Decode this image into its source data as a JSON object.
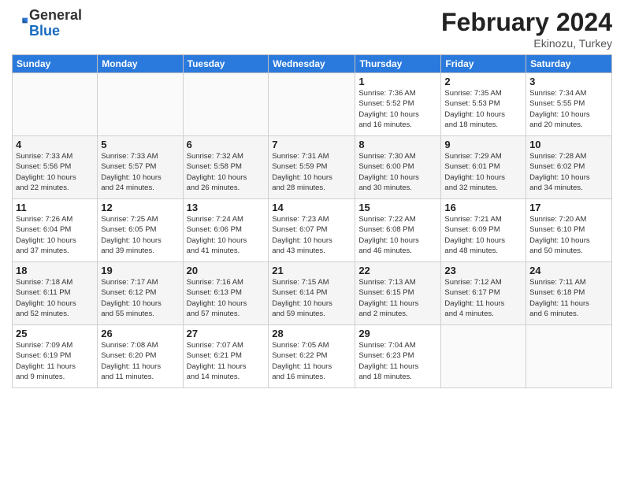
{
  "header": {
    "logo": {
      "general": "General",
      "blue": "Blue"
    },
    "title": "February 2024",
    "subtitle": "Ekinozu, Turkey"
  },
  "weekdays": [
    "Sunday",
    "Monday",
    "Tuesday",
    "Wednesday",
    "Thursday",
    "Friday",
    "Saturday"
  ],
  "weeks": [
    [
      {
        "day": "",
        "info": ""
      },
      {
        "day": "",
        "info": ""
      },
      {
        "day": "",
        "info": ""
      },
      {
        "day": "",
        "info": ""
      },
      {
        "day": "1",
        "info": "Sunrise: 7:36 AM\nSunset: 5:52 PM\nDaylight: 10 hours\nand 16 minutes."
      },
      {
        "day": "2",
        "info": "Sunrise: 7:35 AM\nSunset: 5:53 PM\nDaylight: 10 hours\nand 18 minutes."
      },
      {
        "day": "3",
        "info": "Sunrise: 7:34 AM\nSunset: 5:55 PM\nDaylight: 10 hours\nand 20 minutes."
      }
    ],
    [
      {
        "day": "4",
        "info": "Sunrise: 7:33 AM\nSunset: 5:56 PM\nDaylight: 10 hours\nand 22 minutes."
      },
      {
        "day": "5",
        "info": "Sunrise: 7:33 AM\nSunset: 5:57 PM\nDaylight: 10 hours\nand 24 minutes."
      },
      {
        "day": "6",
        "info": "Sunrise: 7:32 AM\nSunset: 5:58 PM\nDaylight: 10 hours\nand 26 minutes."
      },
      {
        "day": "7",
        "info": "Sunrise: 7:31 AM\nSunset: 5:59 PM\nDaylight: 10 hours\nand 28 minutes."
      },
      {
        "day": "8",
        "info": "Sunrise: 7:30 AM\nSunset: 6:00 PM\nDaylight: 10 hours\nand 30 minutes."
      },
      {
        "day": "9",
        "info": "Sunrise: 7:29 AM\nSunset: 6:01 PM\nDaylight: 10 hours\nand 32 minutes."
      },
      {
        "day": "10",
        "info": "Sunrise: 7:28 AM\nSunset: 6:02 PM\nDaylight: 10 hours\nand 34 minutes."
      }
    ],
    [
      {
        "day": "11",
        "info": "Sunrise: 7:26 AM\nSunset: 6:04 PM\nDaylight: 10 hours\nand 37 minutes."
      },
      {
        "day": "12",
        "info": "Sunrise: 7:25 AM\nSunset: 6:05 PM\nDaylight: 10 hours\nand 39 minutes."
      },
      {
        "day": "13",
        "info": "Sunrise: 7:24 AM\nSunset: 6:06 PM\nDaylight: 10 hours\nand 41 minutes."
      },
      {
        "day": "14",
        "info": "Sunrise: 7:23 AM\nSunset: 6:07 PM\nDaylight: 10 hours\nand 43 minutes."
      },
      {
        "day": "15",
        "info": "Sunrise: 7:22 AM\nSunset: 6:08 PM\nDaylight: 10 hours\nand 46 minutes."
      },
      {
        "day": "16",
        "info": "Sunrise: 7:21 AM\nSunset: 6:09 PM\nDaylight: 10 hours\nand 48 minutes."
      },
      {
        "day": "17",
        "info": "Sunrise: 7:20 AM\nSunset: 6:10 PM\nDaylight: 10 hours\nand 50 minutes."
      }
    ],
    [
      {
        "day": "18",
        "info": "Sunrise: 7:18 AM\nSunset: 6:11 PM\nDaylight: 10 hours\nand 52 minutes."
      },
      {
        "day": "19",
        "info": "Sunrise: 7:17 AM\nSunset: 6:12 PM\nDaylight: 10 hours\nand 55 minutes."
      },
      {
        "day": "20",
        "info": "Sunrise: 7:16 AM\nSunset: 6:13 PM\nDaylight: 10 hours\nand 57 minutes."
      },
      {
        "day": "21",
        "info": "Sunrise: 7:15 AM\nSunset: 6:14 PM\nDaylight: 10 hours\nand 59 minutes."
      },
      {
        "day": "22",
        "info": "Sunrise: 7:13 AM\nSunset: 6:15 PM\nDaylight: 11 hours\nand 2 minutes."
      },
      {
        "day": "23",
        "info": "Sunrise: 7:12 AM\nSunset: 6:17 PM\nDaylight: 11 hours\nand 4 minutes."
      },
      {
        "day": "24",
        "info": "Sunrise: 7:11 AM\nSunset: 6:18 PM\nDaylight: 11 hours\nand 6 minutes."
      }
    ],
    [
      {
        "day": "25",
        "info": "Sunrise: 7:09 AM\nSunset: 6:19 PM\nDaylight: 11 hours\nand 9 minutes."
      },
      {
        "day": "26",
        "info": "Sunrise: 7:08 AM\nSunset: 6:20 PM\nDaylight: 11 hours\nand 11 minutes."
      },
      {
        "day": "27",
        "info": "Sunrise: 7:07 AM\nSunset: 6:21 PM\nDaylight: 11 hours\nand 14 minutes."
      },
      {
        "day": "28",
        "info": "Sunrise: 7:05 AM\nSunset: 6:22 PM\nDaylight: 11 hours\nand 16 minutes."
      },
      {
        "day": "29",
        "info": "Sunrise: 7:04 AM\nSunset: 6:23 PM\nDaylight: 11 hours\nand 18 minutes."
      },
      {
        "day": "",
        "info": ""
      },
      {
        "day": "",
        "info": ""
      }
    ]
  ]
}
